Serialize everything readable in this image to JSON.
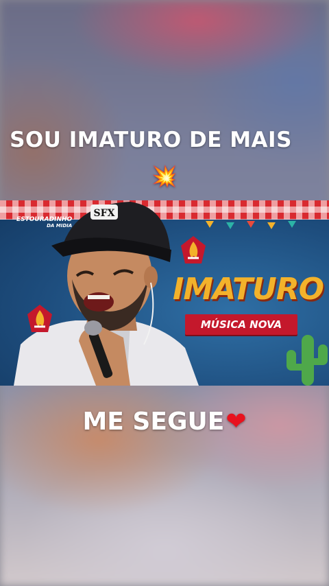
{
  "caption_top": "SOU IMATURO DE MAIS",
  "caption_emoji": "💥",
  "caption_bottom": "ME SEGUE",
  "caption_bottom_emoji": "❤",
  "thumbnail": {
    "brand": "ESTOURADINHO",
    "brand_sub": "DA MIDIA",
    "cap_logo": "SFX",
    "headline": "IMATURO",
    "ribbon": "MÚSICA NOVA"
  },
  "colors": {
    "headline": "#f3b22b",
    "ribbon": "#c4182c",
    "tablecloth": "#d92a30",
    "heart": "#e8121e"
  }
}
